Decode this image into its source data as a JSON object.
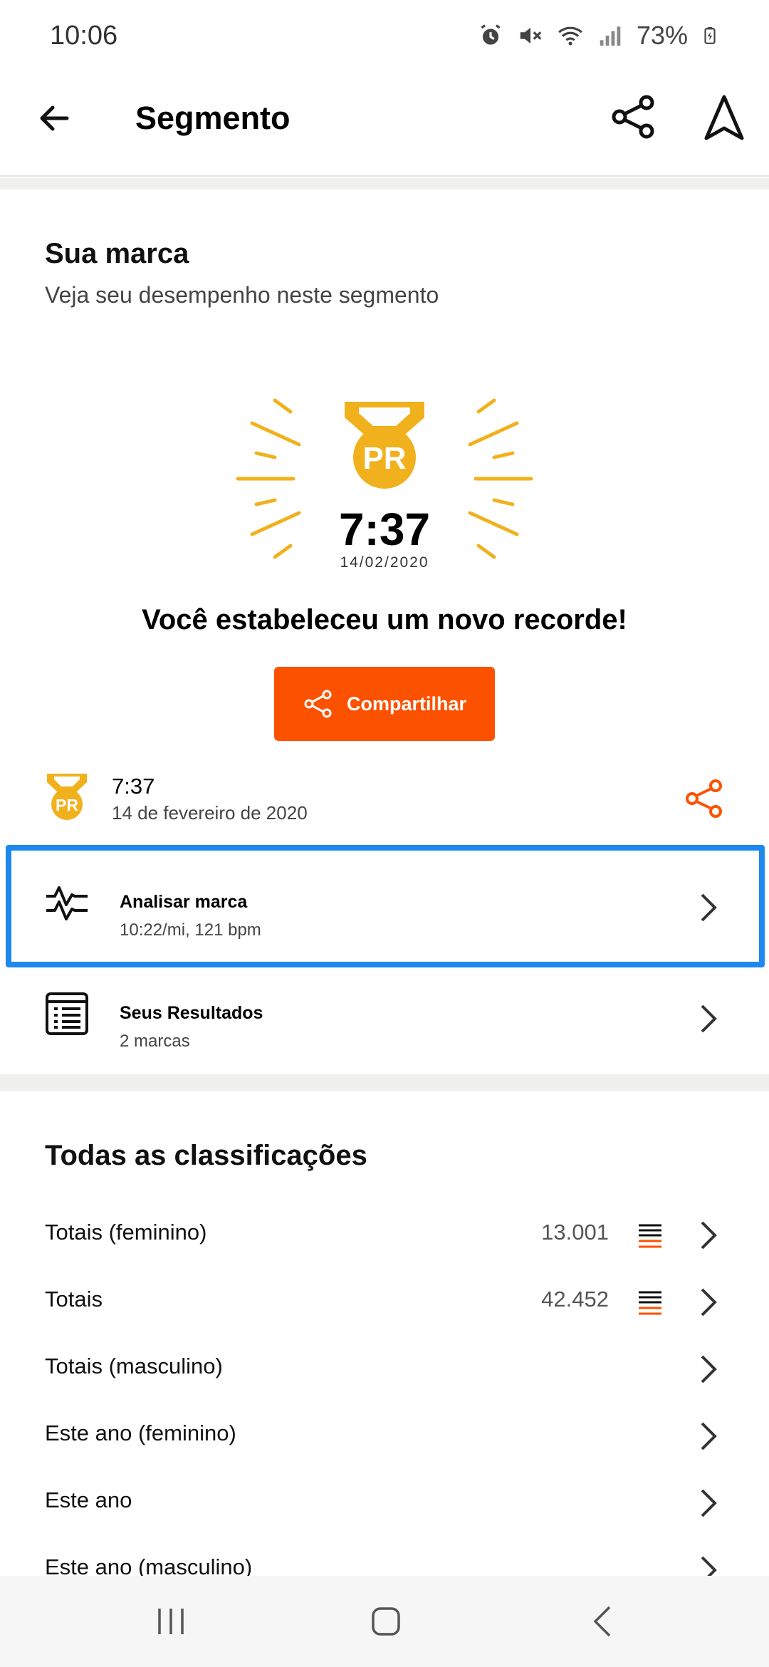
{
  "status": {
    "time": "10:06",
    "battery": "73%"
  },
  "header": {
    "title": "Segmento"
  },
  "your_mark": {
    "title": "Sua marca",
    "subtitle": "Veja seu desempenho neste segmento",
    "badge_text": "PR",
    "time": "7:37",
    "date": "14/02/2020",
    "headline": "Você estabeleceu um novo recorde!",
    "share_label": "Compartilhar"
  },
  "pr_row": {
    "time": "7:37",
    "date": "14 de fevereiro de 2020",
    "badge_text": "PR"
  },
  "analyze": {
    "title": "Analisar marca",
    "subtitle": "10:22/mi, 121 bpm"
  },
  "results": {
    "title": "Seus Resultados",
    "subtitle": "2 marcas"
  },
  "rankings": {
    "title": "Todas as classificações",
    "rows": [
      {
        "label": "Totais (feminino)",
        "value": "13.001"
      },
      {
        "label": "Totais",
        "value": "42.452"
      },
      {
        "label": "Totais (masculino)",
        "value": ""
      },
      {
        "label": "Este ano (feminino)",
        "value": ""
      },
      {
        "label": "Este ano",
        "value": ""
      },
      {
        "label": "Este ano (masculino)",
        "value": ""
      }
    ]
  },
  "colors": {
    "accent": "#fc5200",
    "pr_gold": "#f0b11d",
    "highlight": "#1e88f0"
  }
}
